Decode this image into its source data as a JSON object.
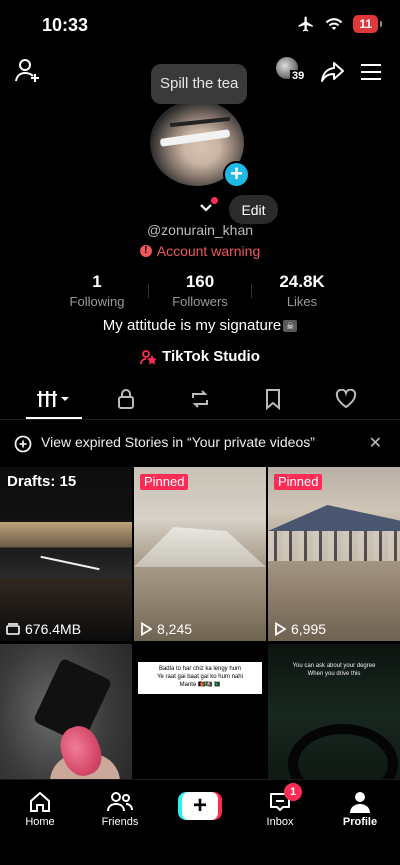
{
  "status_bar": {
    "time": "10:33",
    "battery": "11"
  },
  "header": {
    "notification_count": "39"
  },
  "tooltip": {
    "text": "Spill the tea"
  },
  "profile": {
    "edit_label": "Edit",
    "username": "@zonurain_khan",
    "account_warning": "Account warning",
    "bio": "My attitude is my signature",
    "studio_label": "TikTok Studio"
  },
  "stats": {
    "following": {
      "value": "1",
      "label": "Following"
    },
    "followers": {
      "value": "160",
      "label": "Followers"
    },
    "likes": {
      "value": "24.8K",
      "label": "Likes"
    }
  },
  "banner": {
    "text": "View expired Stories in “Your private videos”"
  },
  "videos": [
    {
      "drafts": "Drafts: 15",
      "size": "676.4MB"
    },
    {
      "pinned": "Pinned",
      "views": "8,245"
    },
    {
      "pinned": "Pinned",
      "views": "6,995"
    },
    {},
    {
      "caption_line1": "Badla to har chiz ka lengy hum",
      "caption_line2": "Ye raat gai baat gai ko hum nahi",
      "caption_line3": "Mante 🇦🇫🏴‍☠️🇵🇰"
    },
    {
      "caption_line1": "You can ask about your degree",
      "caption_line2": "When you drive this"
    }
  ],
  "nav": {
    "home": "Home",
    "friends": "Friends",
    "inbox": "Inbox",
    "inbox_badge": "1",
    "profile": "Profile"
  },
  "colors": {
    "accent": "#fe2c55",
    "cyan": "#25f4ee",
    "plus_badge": "#20b9e6"
  }
}
